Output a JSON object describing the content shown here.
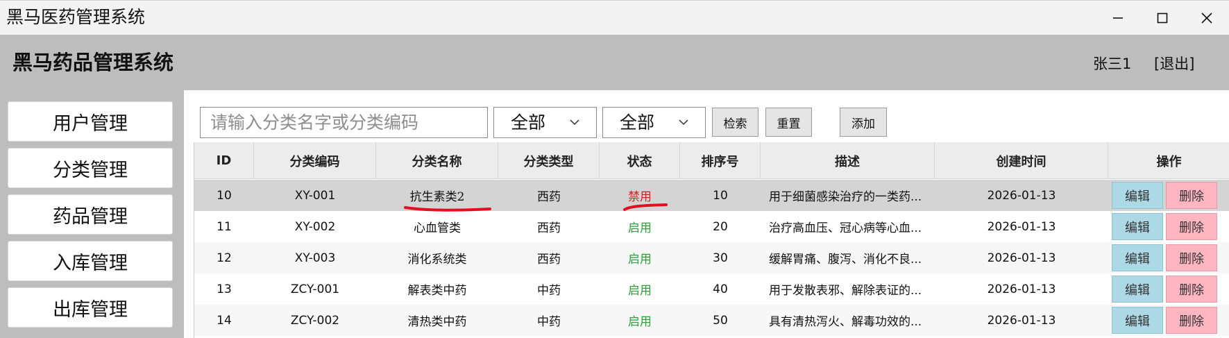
{
  "window": {
    "title": "黑马医药管理系统",
    "controls": [
      "minimize-icon",
      "maximize-icon",
      "close-icon"
    ]
  },
  "header": {
    "title": "黑马药品管理系统",
    "user": "张三1",
    "logout": "[退出]"
  },
  "sidebar": {
    "items": [
      {
        "label": "用户管理"
      },
      {
        "label": "分类管理"
      },
      {
        "label": "药品管理"
      },
      {
        "label": "入库管理"
      },
      {
        "label": "出库管理"
      }
    ]
  },
  "toolbar": {
    "search_placeholder": "请输入分类名字或分类编码",
    "search_value": "",
    "type_filter": "全部",
    "status_filter": "全部",
    "search_label": "检索",
    "reset_label": "重置",
    "add_label": "添加"
  },
  "table": {
    "columns": [
      "ID",
      "分类编码",
      "分类名称",
      "分类类型",
      "状态",
      "排序号",
      "描述",
      "创建时间",
      "操作"
    ],
    "rows": [
      {
        "id": "10",
        "code": "XY-001",
        "name": "抗生素类2",
        "type": "西药",
        "status": "禁用",
        "order": "10",
        "desc": "用于细菌感染治疗的一类药...",
        "created": "2026-01-13",
        "edit": "编辑",
        "delete": "删除"
      },
      {
        "id": "11",
        "code": "XY-002",
        "name": "心血管类",
        "type": "西药",
        "status": "启用",
        "order": "20",
        "desc": "治疗高血压、冠心病等心血...",
        "created": "2026-01-13",
        "edit": "编辑",
        "delete": "删除"
      },
      {
        "id": "12",
        "code": "XY-003",
        "name": "消化系统类",
        "type": "西药",
        "status": "启用",
        "order": "30",
        "desc": "缓解胃痛、腹泻、消化不良...",
        "created": "2026-01-13",
        "edit": "编辑",
        "delete": "删除"
      },
      {
        "id": "13",
        "code": "ZCY-001",
        "name": "解表类中药",
        "type": "中药",
        "status": "启用",
        "order": "40",
        "desc": "用于发散表邪、解除表证的...",
        "created": "2026-01-13",
        "edit": "编辑",
        "delete": "删除"
      },
      {
        "id": "14",
        "code": "ZCY-002",
        "name": "清热类中药",
        "type": "中药",
        "status": "启用",
        "order": "50",
        "desc": "具有清热泻火、解毒功效的...",
        "created": "2026-01-13",
        "edit": "编辑",
        "delete": "删除"
      }
    ],
    "selected_row": 0
  },
  "colors": {
    "header_bg": "#bdbdbd",
    "status_disabled": "#c62828",
    "status_enabled": "#2e9e3b",
    "edit_button": "#add8e6",
    "delete_button": "#ffb6c1",
    "annotation_mark": "#e01020"
  }
}
